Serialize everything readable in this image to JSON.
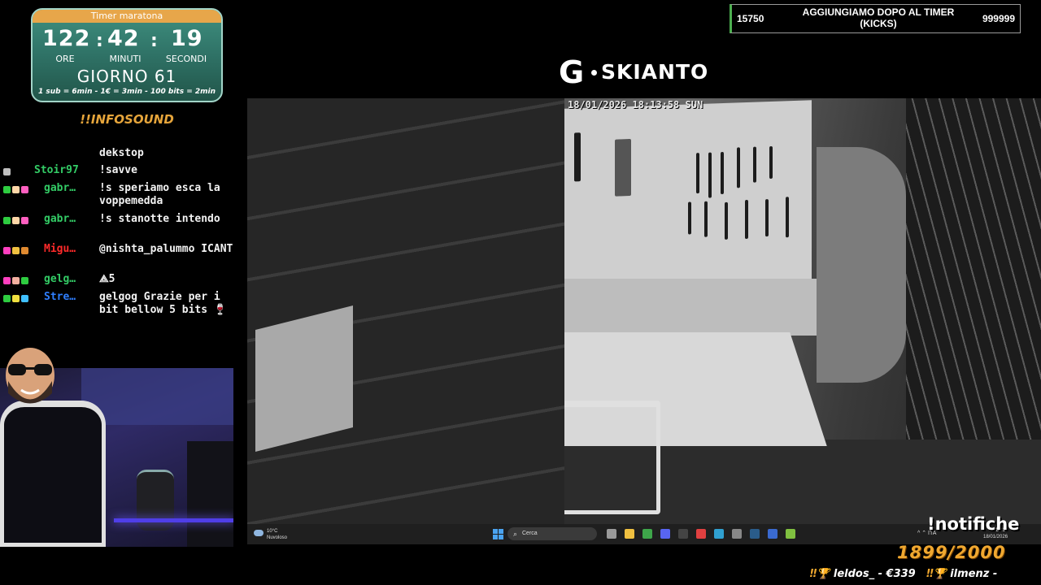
{
  "timer": {
    "title": "Timer maratona",
    "hours": "122",
    "minutes": "42",
    "seconds": "19",
    "separator": ":",
    "hours_label": "ORE",
    "minutes_label": "MINUTI",
    "seconds_label": "SECONDI",
    "day": "GIORNO 61",
    "rates": "1 sub = 6min - 1€ = 3min - 100 bits = 2min"
  },
  "infosound": "!!INFOSOUND",
  "chat": [
    {
      "user": "",
      "user_color": "#33cc66",
      "message": "dekstop",
      "badges": []
    },
    {
      "user": "Stoir97",
      "user_color": "#33cc66",
      "message": "!savve",
      "badges": [
        "#bfbfbf"
      ]
    },
    {
      "user": "gabr…",
      "user_color": "#33cc66",
      "message": "!s speriamo esca la voppemedda",
      "badges": [
        "#2ecc40",
        "#ffd7a8",
        "#ff5fc0"
      ]
    },
    {
      "user": "gabr…",
      "user_color": "#33cc66",
      "message": "!s stanotte intendo",
      "badges": [
        "#2ecc40",
        "#ffd7a8",
        "#ff5fc0"
      ]
    },
    {
      "user": "Migu…",
      "user_color": "#ff2a2a",
      "message": "@nishta_palummo ICANT",
      "badges": [
        "#ff3fbf",
        "#f0c040",
        "#e08a30"
      ]
    },
    {
      "user": "gelg…",
      "user_color": "#33cc66",
      "message": "⟁5",
      "badges": [
        "#ff3fbf",
        "#f3b0a0",
        "#2ecc40"
      ]
    },
    {
      "user": "Stre…",
      "user_color": "#2f7fff",
      "message": "gelgog Grazie per i bit bellow 5 bits 🍷",
      "badges": [
        "#2ecc40",
        "#f0e040",
        "#40c0ff"
      ]
    }
  ],
  "goal": {
    "current": "15750",
    "title": "AGGIUNGIAMO DOPO AL TIMER (KICKS)",
    "target": "999999",
    "accent": "#4caf50"
  },
  "logo": {
    "letter": "G",
    "name": "SKIANTO"
  },
  "camera": {
    "timestamp": "18/01/2026  18:13:58 SUN"
  },
  "taskbar": {
    "temperature": "10°C",
    "weather": "Nuvoloso",
    "search_placeholder": "Cerca",
    "tray": "^  ⌃  ITA",
    "time": "18:13",
    "date": "18/01/2026",
    "apps": [
      {
        "name": "task-view-icon",
        "color": "#9a9a9a"
      },
      {
        "name": "file-explorer-icon",
        "color": "#f0c040"
      },
      {
        "name": "chrome-icon",
        "color": "#3ea64a"
      },
      {
        "name": "discord-icon",
        "color": "#5865f2"
      },
      {
        "name": "obs-icon",
        "color": "#444444"
      },
      {
        "name": "app-red-icon",
        "color": "#e04040"
      },
      {
        "name": "globe-icon",
        "color": "#30a0d0"
      },
      {
        "name": "app-grey-icon",
        "color": "#888888"
      },
      {
        "name": "steam-icon",
        "color": "#2a5c8a"
      },
      {
        "name": "app-r-icon",
        "color": "#3a6ad0"
      },
      {
        "name": "app-green-icon",
        "color": "#80c040"
      }
    ]
  },
  "notifiche": "!notifiche",
  "counter": "1899/2000",
  "ticker": [
    {
      "user": "leldos_",
      "amount": "€339"
    },
    {
      "user": "ilmenz",
      "amount": ""
    }
  ],
  "colors": {
    "timer_bg": "#2f7266",
    "timer_header": "#e7a64a",
    "accent_orange": "#f0a830"
  }
}
